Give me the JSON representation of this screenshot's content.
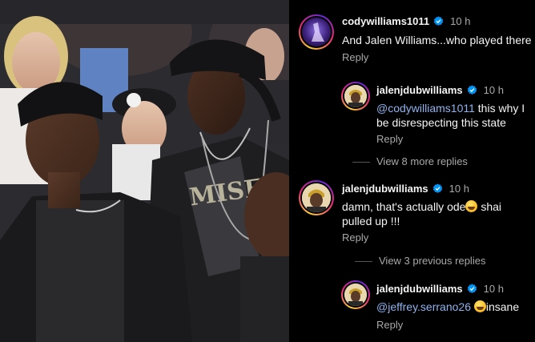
{
  "comments": [
    {
      "username": "codywilliams1011",
      "time": "10 h",
      "text": "And Jalen Williams...who played there",
      "reply_label": "Reply",
      "avatar_icon": "purple-figure-avatar"
    },
    {
      "username": "jalenjdubwilliams",
      "time": "10 h",
      "mention": "@codywilliams1011",
      "text_line1": " this why I",
      "text_line2": "be disrespecting this state",
      "reply_label": "Reply",
      "avatar_icon": "durag-portrait-avatar"
    },
    {
      "username": "jalenjdubwilliams",
      "time": "10 h",
      "text_line1a": "damn, that's actually ode",
      "text_line1b": " shai",
      "text_line2": "pulled up !!!",
      "reply_label": "Reply",
      "avatar_icon": "durag-portrait-avatar"
    },
    {
      "username": "jalenjdubwilliams",
      "time": "10 h",
      "mention": "@jeffrey.serrano26",
      "text_after": "insane",
      "reply_label": "Reply",
      "avatar_icon": "durag-portrait-avatar"
    }
  ],
  "view_more_replies": "View 8 more replies",
  "view_previous_replies": "View 3 previous replies",
  "colors": {
    "background": "#000000",
    "text": "#f5f5f5",
    "secondary_text": "#a8a8a8",
    "mention": "#8fb2ee",
    "verified_badge": "#0095f6"
  }
}
